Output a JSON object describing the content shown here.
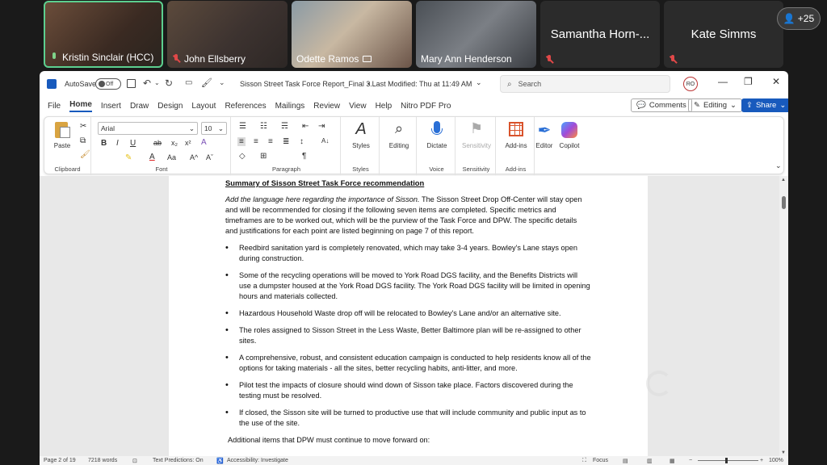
{
  "participants": [
    {
      "name": "Kristin Sinclair (HCC)",
      "mic": "on",
      "active": true
    },
    {
      "name": "John Ellsberry",
      "mic": "off"
    },
    {
      "name": "Odette Ramos",
      "mic": "share"
    },
    {
      "name": "Mary Ann Henderson",
      "mic": "none"
    },
    {
      "name": "Samantha Horn-...",
      "mic": "off"
    },
    {
      "name": "Kate Simms",
      "mic": "off"
    }
  ],
  "more_participants": "+25",
  "titlebar": {
    "autosave_label": "AutoSave",
    "autosave_state": "Off",
    "doc_title": "Sisson Street Task Force Report_Final 3...",
    "modified": "• Last Modified: Thu at 11:49 AM",
    "search_placeholder": "Search",
    "avatar_initials": "RO"
  },
  "menu": {
    "items": [
      "File",
      "Home",
      "Insert",
      "Draw",
      "Design",
      "Layout",
      "References",
      "Mailings",
      "Review",
      "View",
      "Help",
      "Nitro PDF Pro"
    ],
    "active": "Home",
    "comments": "Comments",
    "editing": "Editing",
    "share": "Share"
  },
  "ribbon": {
    "clipboard": {
      "paste": "Paste",
      "label": "Clipboard"
    },
    "font": {
      "name": "Arial",
      "size": "10",
      "label": "Font"
    },
    "paragraph": {
      "label": "Paragraph"
    },
    "styles": {
      "btn": "Styles",
      "label": "Styles"
    },
    "editing": {
      "btn": "Editing"
    },
    "voice": {
      "btn": "Dictate",
      "label": "Voice"
    },
    "sensitivity": {
      "btn": "Sensitivity",
      "label": "Sensitivity"
    },
    "addins": {
      "btn": "Add-ins",
      "label": "Add-ins"
    },
    "editor": "Editor",
    "copilot": "Copilot"
  },
  "document": {
    "heading": "Summary of Sisson Street Task Force recommendation",
    "intro_italic": "Add the language here regarding the importance of Sisson.",
    "intro_rest": " The Sisson Street Drop Off-Center will stay open and will be recommended for closing if the following seven items are completed. Specific metrics and timeframes are to be worked out, which will be the purview of the Task Force and DPW.  The specific details and justifications for each point are listed beginning on page 7 of this report.",
    "bullets": [
      "Reedbird sanitation yard is completely renovated, which may take 3-4 years. Bowley's Lane stays open during construction.",
      "Some of the recycling operations will be moved to York Road DGS facility, and the Benefits Districts will use a dumpster housed at the York Road DGS facility. The York Road DGS facility will be limited in opening hours and materials collected.",
      "Hazardous Household Waste drop off will be relocated to Bowley's Lane and/or an alternative site.",
      "The roles assigned to Sisson Street in the Less Waste, Better Baltimore plan will be re-assigned to other sites.",
      "A comprehensive, robust, and consistent education campaign is conducted to help residents know all of the options for taking materials - all the sites, better recycling habits, anti-litter, and more.",
      "Pilot test the impacts of closure should wind down of Sisson take place. Factors discovered during the testing must be resolved.",
      "If closed, the Sisson site will be turned to productive use that will include community and public input as to the use of the site."
    ],
    "additional": "Additional items that DPW must continue to move forward on:"
  },
  "status": {
    "page": "Page 2 of 19",
    "words": "7218 words",
    "predictions": "Text Predictions: On",
    "accessibility": "Accessibility: Investigate",
    "focus": "Focus",
    "zoom": "100%"
  },
  "watermark": {
    "line1": "CHARM",
    "line2": "TV"
  }
}
